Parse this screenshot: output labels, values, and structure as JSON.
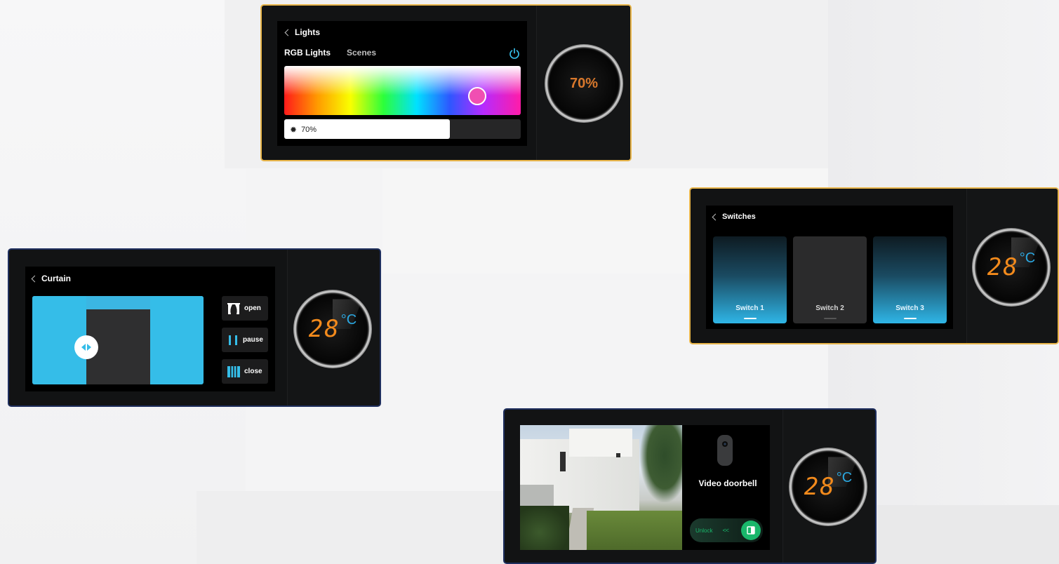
{
  "lights": {
    "back_title": "Lights",
    "tabs": [
      "RGB Lights",
      "Scenes"
    ],
    "brightness_label": "70%",
    "brightness_level": 0.7,
    "knob_value": "70%"
  },
  "switches": {
    "back_title": "Switches",
    "items": [
      {
        "label": "Switch 1",
        "state": "on"
      },
      {
        "label": "Switch 2",
        "state": "off"
      },
      {
        "label": "Switch 3",
        "state": "on"
      }
    ],
    "temp_digits": "28",
    "temp_unit": "°C"
  },
  "curtain": {
    "back_title": "Curtain",
    "buttons": [
      "open",
      "pause",
      "close"
    ],
    "temp_digits": "28",
    "temp_unit": "°C"
  },
  "doorbell": {
    "title": "Video doorbell",
    "unlock_label": "Unlock",
    "unlock_arrows": "<<",
    "temp_digits": "28",
    "temp_unit": "°C"
  },
  "colors": {
    "gold_border": "#e8b54a",
    "navy_border": "#1f2f5e",
    "accent_blue": "#35bde8",
    "temp_orange": "#f28a1c",
    "unlock_green": "#19b76b"
  }
}
